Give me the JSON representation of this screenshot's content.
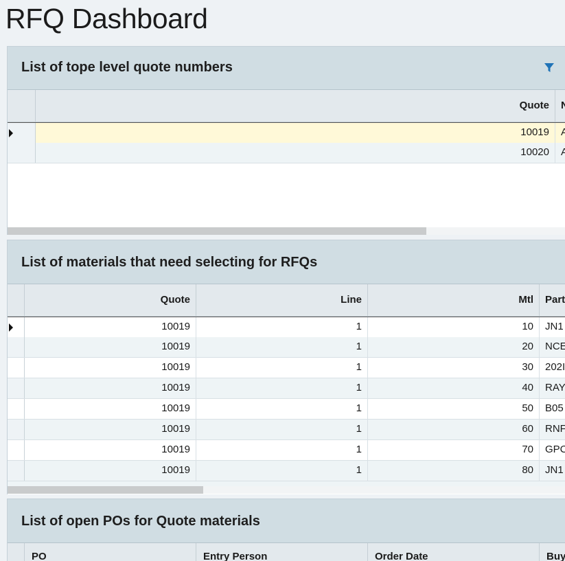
{
  "page": {
    "title": "RFQ Dashboard"
  },
  "panel1": {
    "title": "List of tope level quote numbers",
    "columns": {
      "quote": "Quote",
      "next": "N"
    },
    "rows": [
      {
        "quote": "10019",
        "next": "A"
      },
      {
        "quote": "10020",
        "next": "A"
      }
    ],
    "selected_row": 0,
    "scroll_fraction": 0.75
  },
  "panel2": {
    "title": "List of materials that need selecting for RFQs",
    "columns": {
      "quote": "Quote",
      "line": "Line",
      "mtl": "Mtl",
      "part": "Part"
    },
    "rows": [
      {
        "quote": "10019",
        "line": "1",
        "mtl": "10",
        "part": "JN1"
      },
      {
        "quote": "10019",
        "line": "1",
        "mtl": "20",
        "part": "NCE"
      },
      {
        "quote": "10019",
        "line": "1",
        "mtl": "30",
        "part": "202I"
      },
      {
        "quote": "10019",
        "line": "1",
        "mtl": "40",
        "part": "RAY"
      },
      {
        "quote": "10019",
        "line": "1",
        "mtl": "50",
        "part": "B05"
      },
      {
        "quote": "10019",
        "line": "1",
        "mtl": "60",
        "part": "RNF"
      },
      {
        "quote": "10019",
        "line": "1",
        "mtl": "70",
        "part": "GPC"
      },
      {
        "quote": "10019",
        "line": "1",
        "mtl": "80",
        "part": "JN1"
      }
    ],
    "selected_row": 0,
    "scroll_fraction": 0.35
  },
  "panel3": {
    "title": "List of open POs for Quote materials",
    "columns": {
      "po": "PO",
      "entry_person": "Entry Person",
      "order_date": "Order Date",
      "buyer": "Buy"
    }
  },
  "colors": {
    "accent": "#1f73b7",
    "header_bg": "#d0dde3",
    "selected_bg": "#fff9d8"
  },
  "icons": {
    "filter": "filter-icon",
    "row_selector": "triangle-right-icon"
  }
}
